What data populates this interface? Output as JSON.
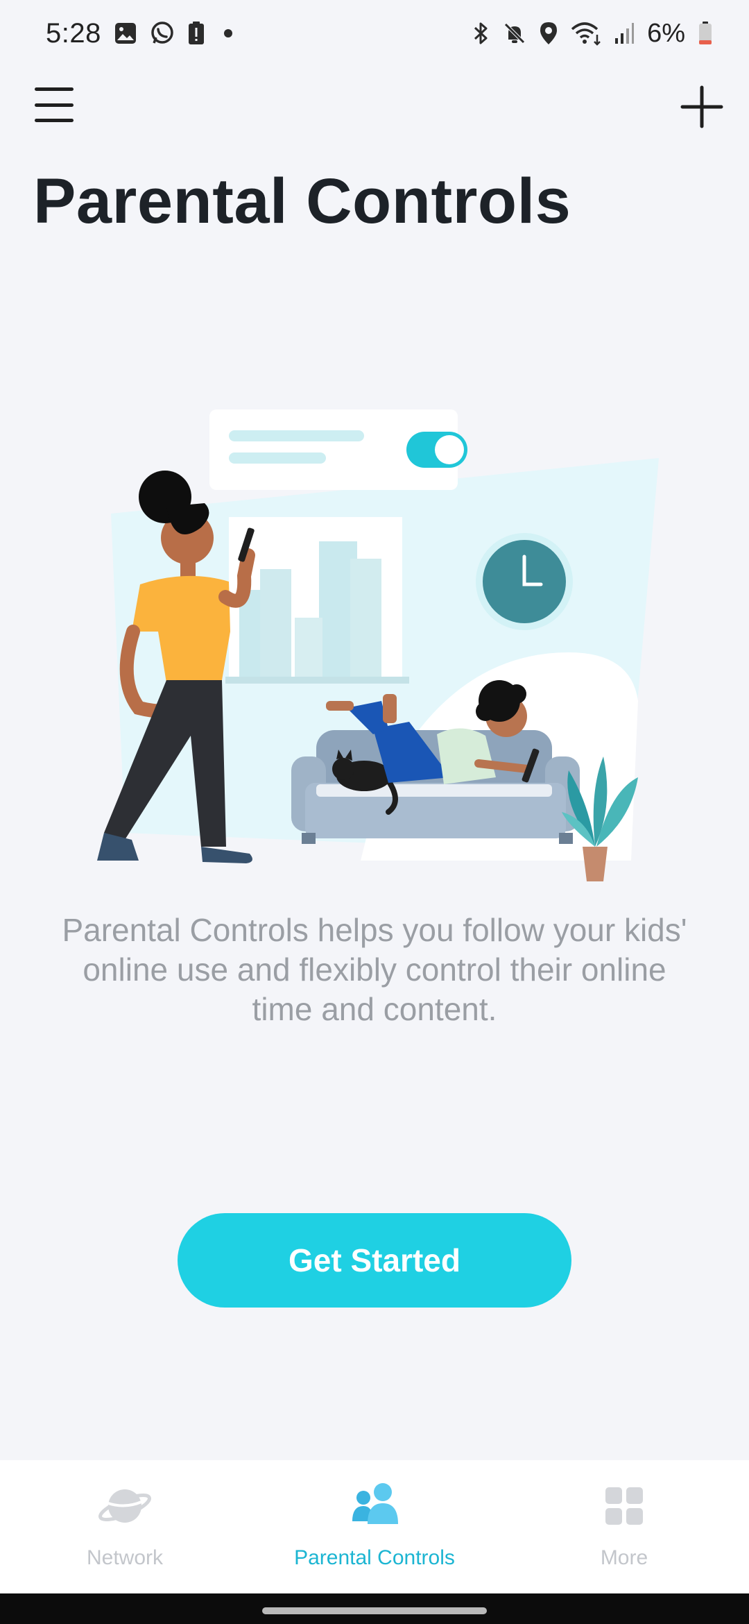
{
  "status_bar": {
    "time": "5:28",
    "battery_percent": "6%",
    "left_icons": [
      "gallery-icon",
      "whatsapp-icon",
      "alert-icon",
      "dot-icon"
    ],
    "right_icons": [
      "bluetooth-icon",
      "mute-icon",
      "location-icon",
      "wifi-icon",
      "signal-icon",
      "battery-icon"
    ]
  },
  "header": {
    "menu_icon": "hamburger-menu-icon",
    "add_icon": "plus-icon",
    "title": "Parental Controls"
  },
  "main": {
    "description": "Parental Controls helps you follow your kids' online use and flexibly control their online time and content.",
    "cta_label": "Get Started",
    "illustration": {
      "toggle_on": true,
      "clock_time": "3:00"
    }
  },
  "bottom_nav": {
    "items": [
      {
        "label": "Network",
        "icon": "planet-icon",
        "active": false
      },
      {
        "label": "Parental Controls",
        "icon": "people-icon",
        "active": true
      },
      {
        "label": "More",
        "icon": "grid-icon",
        "active": false
      }
    ]
  },
  "colors": {
    "accent": "#1fd0e3",
    "active_nav": "#1cb5d2",
    "inactive_nav": "#c3c6cb",
    "background": "#f4f5f9",
    "title": "#1d2228"
  }
}
